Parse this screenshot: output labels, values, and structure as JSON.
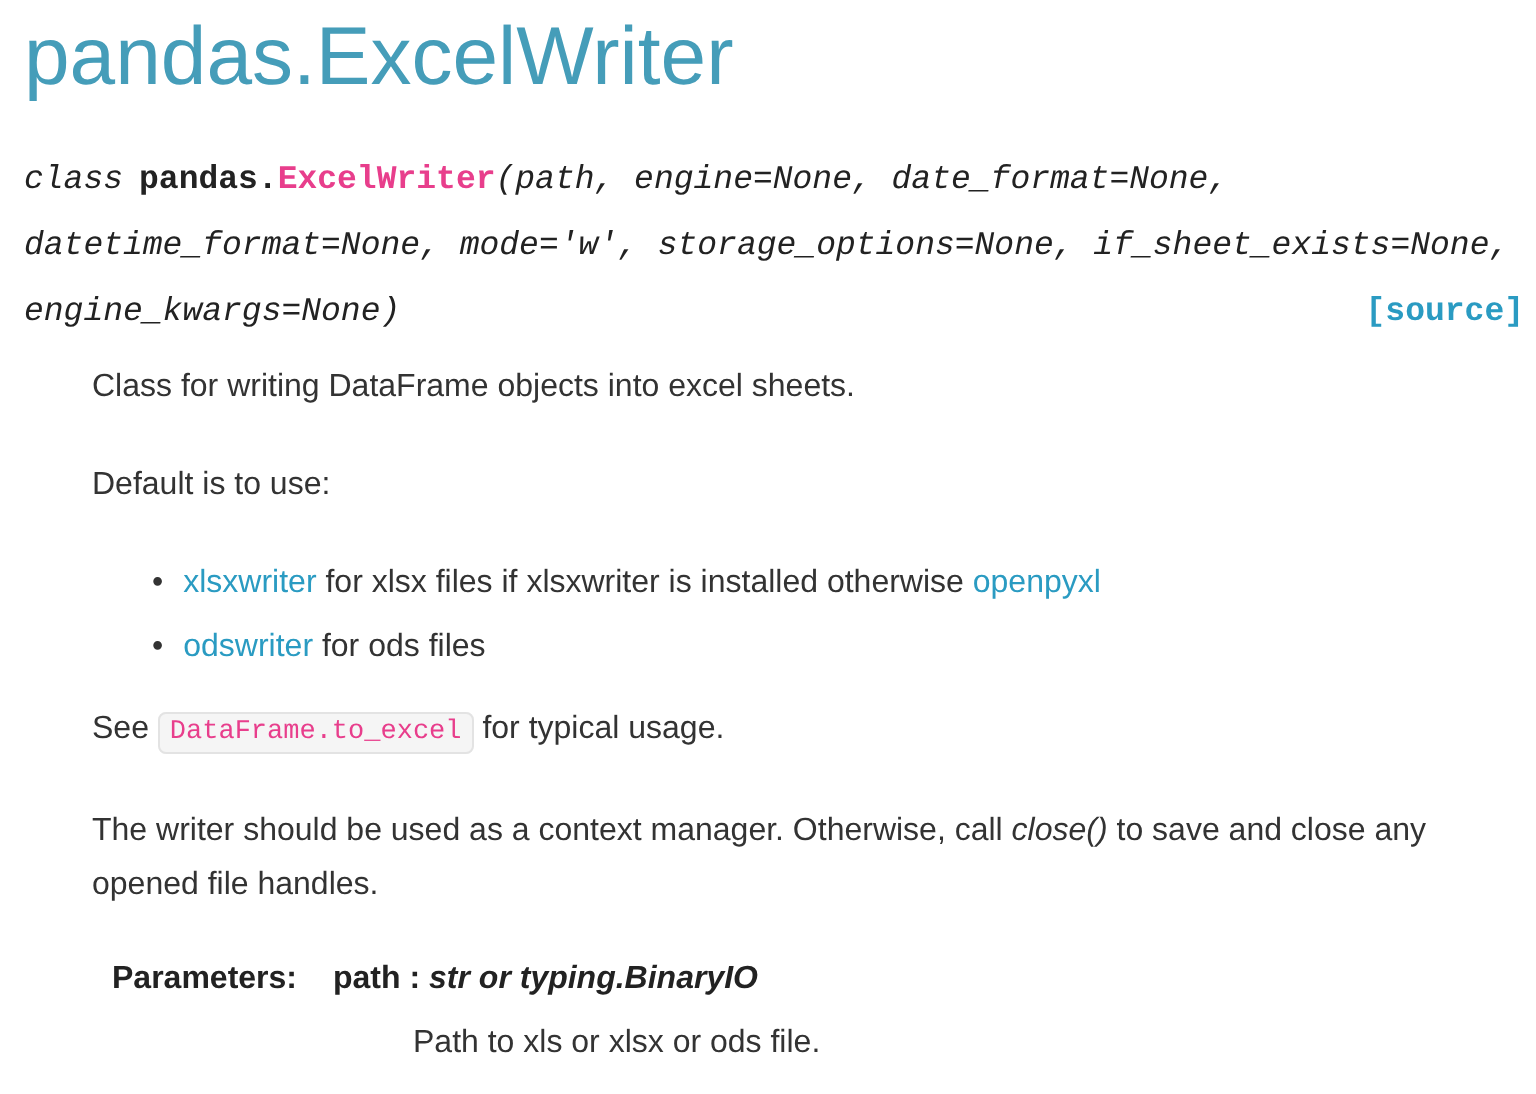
{
  "title": "pandas.ExcelWriter",
  "signature": {
    "keyword": "class",
    "module": "pandas.",
    "name": "ExcelWriter",
    "param_lines": [
      "(path, engine=None, date_format=None,",
      "datetime_format=None, mode='w', storage_options=None, if_sheet_exists=None,",
      "engine_kwargs=None)"
    ],
    "source": "[source]"
  },
  "summary": "Class for writing DataFrame objects into excel sheets.",
  "default_intro": "Default is to use:",
  "engines": [
    {
      "marker": "•",
      "segments": [
        {
          "kind": "link",
          "text": "xlsxwriter"
        },
        {
          "kind": "text",
          "text": " for xlsx files if xlsxwriter is installed otherwise "
        },
        {
          "kind": "link",
          "text": "openpyxl"
        }
      ]
    },
    {
      "marker": "•",
      "segments": [
        {
          "kind": "link",
          "text": "odswriter"
        },
        {
          "kind": "text",
          "text": " for ods files"
        }
      ]
    }
  ],
  "see_also": {
    "before": "See",
    "code": "DataFrame.to_excel",
    "after": "for typical usage."
  },
  "note": "The writer should be used as a context manager. Otherwise, call *close()* to save and close any opened file handles.",
  "parameters": {
    "label": "Parameters:",
    "items": [
      {
        "name": "path",
        "separator": ":",
        "type": "str or typing.BinaryIO",
        "description": "Path to xls or xlsx or ods file."
      }
    ]
  }
}
